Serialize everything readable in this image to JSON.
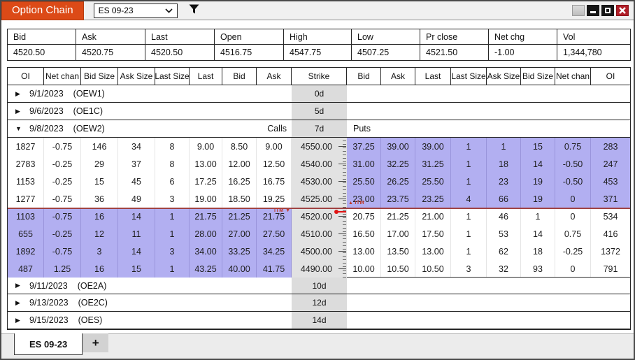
{
  "titlebar": {
    "app_label": "Option Chain",
    "instrument": "ES 09-23",
    "icons": {
      "dropdown": "chevron-down-icon",
      "filter": "funnel-icon",
      "buttons": [
        "blank-icon",
        "minimize-icon",
        "maximize-icon",
        "close-icon"
      ]
    }
  },
  "summary": {
    "columns": [
      "Bid",
      "Ask",
      "Last",
      "Open",
      "High",
      "Low",
      "Pr close",
      "Net chg",
      "Vol"
    ],
    "values": [
      "4520.50",
      "4520.75",
      "4520.50",
      "4516.75",
      "4547.75",
      "4507.25",
      "4521.50",
      "-1.00",
      "1,344,780"
    ]
  },
  "chain": {
    "headers_calls": [
      "OI",
      "Net chan",
      "Bid Size",
      "Ask Size",
      "Last Size",
      "Last",
      "Bid",
      "Ask"
    ],
    "header_strike": "Strike",
    "headers_puts": [
      "Bid",
      "Ask",
      "Last",
      "Last Size",
      "Ask Size",
      "Bid Size",
      "Net chan",
      "OI"
    ],
    "itm_label": "ITM",
    "groups_top": [
      {
        "date": "9/1/2023",
        "code": "(OEW1)",
        "days": "0d"
      },
      {
        "date": "9/6/2023",
        "code": "(OE1C)",
        "days": "5d"
      }
    ],
    "expanded_group": {
      "date": "9/8/2023",
      "code": "(OEW2)",
      "days": "7d",
      "calls_label": "Calls",
      "puts_label": "Puts",
      "rows": [
        {
          "strike": "4550.00",
          "calls": [
            "1827",
            "-0.75",
            "146",
            "34",
            "8",
            "9.00",
            "8.50",
            "9.00"
          ],
          "puts": [
            "37.25",
            "39.00",
            "39.00",
            "1",
            "1",
            "15",
            "0.75",
            "283"
          ]
        },
        {
          "strike": "4540.00",
          "calls": [
            "2783",
            "-0.25",
            "29",
            "37",
            "8",
            "13.00",
            "12.00",
            "12.50"
          ],
          "puts": [
            "31.00",
            "32.25",
            "31.25",
            "1",
            "18",
            "14",
            "-0.50",
            "247"
          ]
        },
        {
          "strike": "4530.00",
          "calls": [
            "1153",
            "-0.25",
            "15",
            "45",
            "6",
            "17.25",
            "16.25",
            "16.75"
          ],
          "puts": [
            "25.50",
            "26.25",
            "25.50",
            "1",
            "23",
            "19",
            "-0.50",
            "453"
          ]
        },
        {
          "strike": "4525.00",
          "calls": [
            "1277",
            "-0.75",
            "36",
            "49",
            "3",
            "19.00",
            "18.50",
            "19.25"
          ],
          "puts": [
            "23.00",
            "23.75",
            "23.25",
            "4",
            "66",
            "19",
            "0",
            "371"
          ]
        },
        {
          "strike": "4520.00",
          "calls": [
            "1103",
            "-0.75",
            "16",
            "14",
            "1",
            "21.75",
            "21.25",
            "21.75"
          ],
          "puts": [
            "20.75",
            "21.25",
            "21.00",
            "1",
            "46",
            "1",
            "0",
            "534"
          ]
        },
        {
          "strike": "4510.00",
          "calls": [
            "655",
            "-0.25",
            "12",
            "11",
            "1",
            "28.00",
            "27.00",
            "27.50"
          ],
          "puts": [
            "16.50",
            "17.00",
            "17.50",
            "1",
            "53",
            "14",
            "0.75",
            "416"
          ]
        },
        {
          "strike": "4500.00",
          "calls": [
            "1892",
            "-0.75",
            "3",
            "14",
            "3",
            "34.00",
            "33.25",
            "34.25"
          ],
          "puts": [
            "13.00",
            "13.50",
            "13.00",
            "1",
            "62",
            "18",
            "-0.25",
            "1372"
          ]
        },
        {
          "strike": "4490.00",
          "calls": [
            "487",
            "1.25",
            "16",
            "15",
            "1",
            "43.25",
            "40.00",
            "41.75"
          ],
          "puts": [
            "10.00",
            "10.50",
            "10.50",
            "3",
            "32",
            "93",
            "0",
            "791"
          ]
        }
      ]
    },
    "groups_bottom": [
      {
        "date": "9/11/2023",
        "code": "(OE2A)",
        "days": "10d"
      },
      {
        "date": "9/13/2023",
        "code": "(OE2C)",
        "days": "12d"
      },
      {
        "date": "9/15/2023",
        "code": "(OES)",
        "days": "14d"
      }
    ]
  },
  "tabs": {
    "active": "ES 09-23",
    "add": "+"
  },
  "colors": {
    "accent_orange": "#dc4a17",
    "itm_highlight": "#b2aff1",
    "price_line": "#a04343",
    "price_marker": "#e01313",
    "close_button": "#b01e28",
    "strike_gray": "#e2e2e2"
  }
}
